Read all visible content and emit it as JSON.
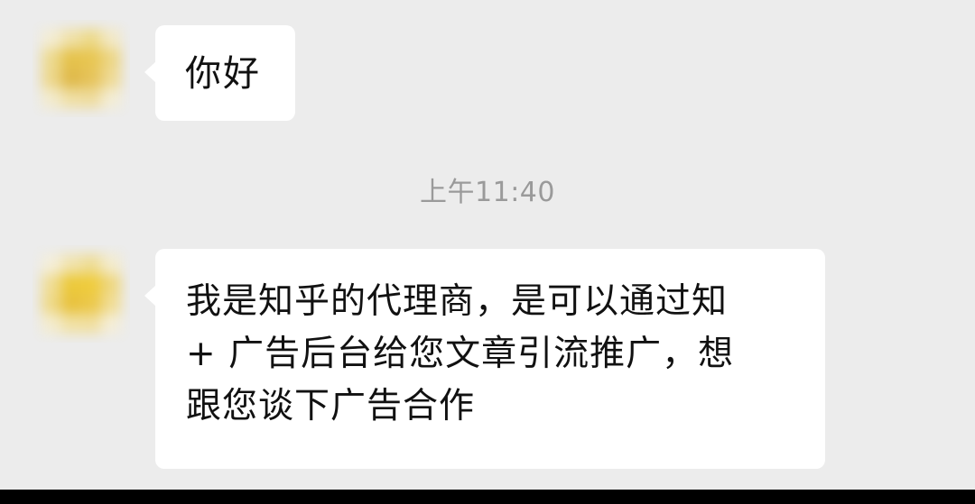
{
  "chat": {
    "messages": [
      {
        "sender": "contact",
        "avatar": "blurred-avatar",
        "text": "你好"
      },
      {
        "sender": "contact",
        "avatar": "blurred-avatar",
        "text": "我是知乎的代理商，是可以通过知\n+ 广告后台给您文章引流推广，想\n跟您谈下广告合作"
      }
    ],
    "timestamp": "上午11:40"
  },
  "colors": {
    "background": "#ececec",
    "bubble": "#ffffff",
    "text": "#111111",
    "timestamp": "#9a9a9a",
    "avatar_blur": "#e8c64a"
  }
}
